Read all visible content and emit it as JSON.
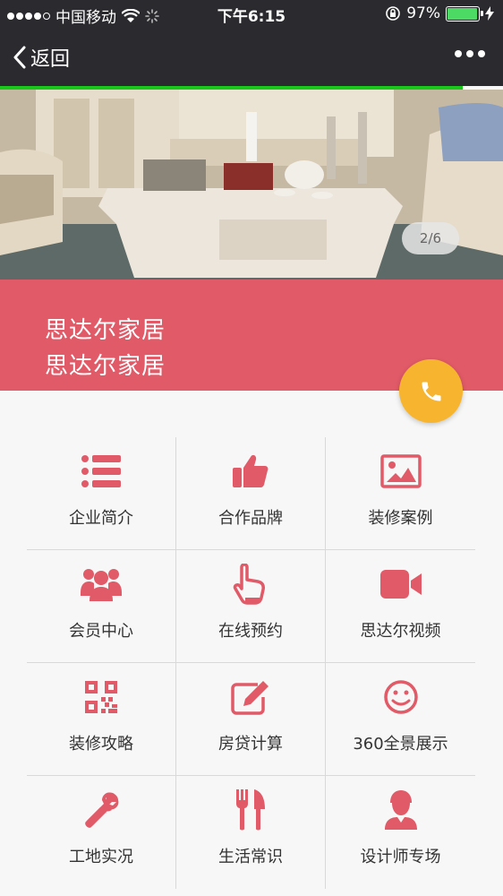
{
  "status_bar": {
    "carrier": "中国移动",
    "time": "下午6:15",
    "battery": "97%",
    "battery_level": 0.97
  },
  "nav": {
    "back_label": "返回",
    "load_progress": 0.92
  },
  "banner": {
    "page_indicator": "2/6"
  },
  "header": {
    "title": "思达尔家居",
    "subtitle": "思达尔家居"
  },
  "colors": {
    "accent": "#e15a68",
    "phone_button": "#f7b52f",
    "progress": "#18c719"
  },
  "menu": [
    {
      "label": "企业简介",
      "icon": "list-icon"
    },
    {
      "label": "合作品牌",
      "icon": "thumbs-up-icon"
    },
    {
      "label": "装修案例",
      "icon": "picture-icon"
    },
    {
      "label": "会员中心",
      "icon": "users-icon"
    },
    {
      "label": "在线预约",
      "icon": "pointer-hand-icon"
    },
    {
      "label": "思达尔视频",
      "icon": "video-camera-icon"
    },
    {
      "label": "装修攻略",
      "icon": "qr-code-icon"
    },
    {
      "label": "房贷计算",
      "icon": "edit-icon"
    },
    {
      "label": "360全景展示",
      "icon": "smile-icon"
    },
    {
      "label": "工地实况",
      "icon": "wrench-icon"
    },
    {
      "label": "生活常识",
      "icon": "fork-knife-icon"
    },
    {
      "label": "设计师专场",
      "icon": "designer-icon"
    }
  ]
}
